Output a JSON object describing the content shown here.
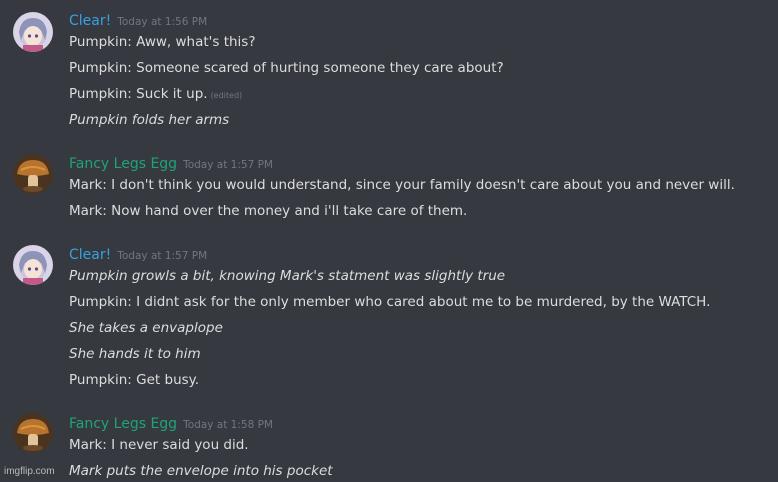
{
  "colors": {
    "background": "#36393f",
    "clear_name": "#3aa0e0",
    "egg_name": "#1fa37a",
    "timestamp": "#72767d",
    "text": "#dcddde"
  },
  "messages": [
    {
      "author": "Clear!",
      "avatar": "anime-character-avatar",
      "timestamp": "Today at 1:56 PM",
      "lines": [
        {
          "text": "Pumpkin: Aww, what's this?"
        },
        {
          "text": "Pumpkin: Someone scared of hurting someone they care about?"
        },
        {
          "text": "Pumpkin: Suck it up.",
          "edited": "(edited)"
        },
        {
          "text": "Pumpkin folds her arms"
        }
      ]
    },
    {
      "author": "Fancy Legs Egg",
      "avatar": "mushroom-avatar",
      "timestamp": "Today at 1:57 PM",
      "lines": [
        {
          "text": "Mark: I don't think you would understand, since your family doesn't care about you and never will."
        },
        {
          "text": "Mark: Now hand over the money and i'll take care of them."
        }
      ]
    },
    {
      "author": "Clear!",
      "avatar": "anime-character-avatar",
      "timestamp": "Today at 1:57 PM",
      "lines": [
        {
          "text": "Pumpkin growls a bit, knowing Mark's statment was slightly true"
        },
        {
          "text": "Pumpkin: I didnt ask for the only member who cared about me to be murdered, by the WATCH."
        },
        {
          "text": "She takes a envaplope"
        },
        {
          "text": "She hands it to him"
        },
        {
          "text": "Pumpkin: Get busy."
        }
      ]
    },
    {
      "author": "Fancy Legs Egg",
      "avatar": "mushroom-avatar",
      "timestamp": "Today at 1:58 PM",
      "lines": [
        {
          "text": "Mark: I never said you did."
        },
        {
          "text": "Mark puts the envelope into his pocket"
        }
      ]
    }
  ],
  "watermark": "imgflip.com"
}
